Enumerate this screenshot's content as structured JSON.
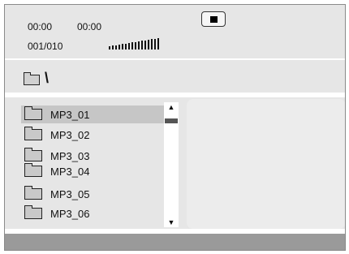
{
  "status": {
    "elapsed_time": "00:00",
    "total_time": "00:00",
    "track_counter": "001/010",
    "volume_bars": 16
  },
  "controls": {
    "stop_button": "stop-icon"
  },
  "path": {
    "current": "\\"
  },
  "file_list": {
    "items": [
      {
        "label": "MP3_01",
        "selected": true
      },
      {
        "label": "MP3_02",
        "selected": false
      },
      {
        "label": "MP3_03",
        "selected": false
      },
      {
        "label": "MP3_04",
        "selected": false
      },
      {
        "label": "MP3_05",
        "selected": false
      },
      {
        "label": "MP3_06",
        "selected": false
      }
    ]
  },
  "scrollbar": {
    "up_arrow": "▲",
    "down_arrow": "▼"
  },
  "colors": {
    "panel_background": "#e6e6e6",
    "selected_row": "#c6c6c6",
    "bottom_bar": "#9a9a9a"
  }
}
